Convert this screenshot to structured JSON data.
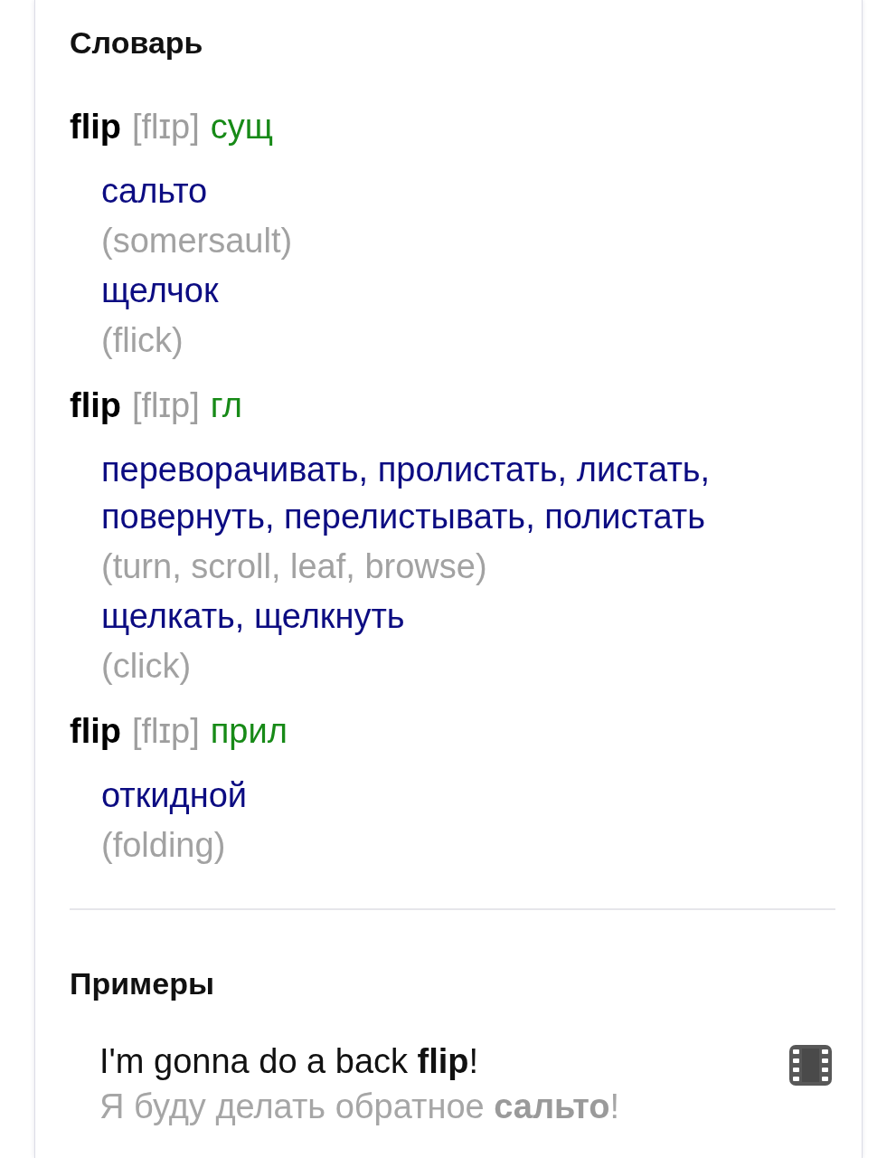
{
  "dictionary": {
    "title": "Словарь",
    "entries": [
      {
        "word": "flip",
        "transcription": "[flɪp]",
        "part_of_speech": "сущ",
        "senses": [
          {
            "translation": "сальто",
            "back_translation": "(somersault)"
          },
          {
            "translation": "щелчок",
            "back_translation": "(flick)"
          }
        ]
      },
      {
        "word": "flip",
        "transcription": "[flɪp]",
        "part_of_speech": "гл",
        "senses": [
          {
            "translation": "переворачивать, пролистать, листать, повернуть, перелистывать, полистать",
            "back_translation": "(turn, scroll, leaf, browse)"
          },
          {
            "translation": "щелкать, щелкнуть",
            "back_translation": "(click)"
          }
        ]
      },
      {
        "word": "flip",
        "transcription": "[flɪp]",
        "part_of_speech": "прил",
        "senses": [
          {
            "translation": "откидной",
            "back_translation": "(folding)"
          }
        ]
      }
    ]
  },
  "examples": {
    "title": "Примеры",
    "items": [
      {
        "source": "I'm gonna do a back **flip**!",
        "translation": "Я буду делать обратное **сальто**!"
      }
    ]
  }
}
